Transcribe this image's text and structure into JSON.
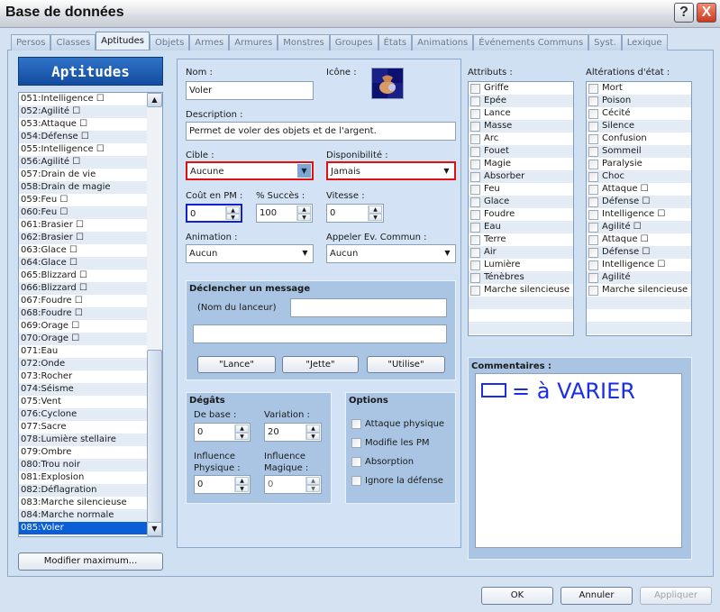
{
  "window": {
    "title": "Base de données",
    "help_label": "?",
    "close_label": "X"
  },
  "tabs": [
    "Persos",
    "Classes",
    "Aptitudes",
    "Objets",
    "Armes",
    "Armures",
    "Monstres",
    "Groupes",
    "États",
    "Animations",
    "Événements Communs",
    "Syst.",
    "Lexique"
  ],
  "active_tab": "Aptitudes",
  "sidebar": {
    "title": "Aptitudes",
    "items": [
      "051:Intelligence ☐",
      "052:Agilité ☐",
      "053:Attaque ☐",
      "054:Défense ☐",
      "055:Intelligence ☐",
      "056:Agilité ☐",
      "057:Drain de vie",
      "058:Drain de magie",
      "059:Feu ☐",
      "060:Feu ☐",
      "061:Brasier ☐",
      "062:Brasier ☐",
      "063:Glace ☐",
      "064:Glace ☐",
      "065:Blizzard ☐",
      "066:Blizzard ☐",
      "067:Foudre ☐",
      "068:Foudre ☐",
      "069:Orage ☐",
      "070:Orage ☐",
      "071:Eau",
      "072:Onde",
      "073:Rocher",
      "074:Séisme",
      "075:Vent",
      "076:Cyclone",
      "077:Sacre",
      "078:Lumière stellaire",
      "079:Ombre",
      "080:Trou noir",
      "081:Explosion",
      "082:Déflagration",
      "083:Marche silencieuse",
      "084:Marche normale",
      "085:Voler"
    ],
    "selected": "085:Voler",
    "max_button": "Modifier maximum..."
  },
  "form": {
    "name_label": "Nom :",
    "name_value": "Voler",
    "icon_label": "Icône :",
    "desc_label": "Description :",
    "desc_value": "Permet de voler des objets et de l'argent.",
    "target_label": "Cible :",
    "target_value": "Aucune",
    "avail_label": "Disponibilité :",
    "avail_value": "Jamais",
    "mp_label": "Coût en PM :",
    "mp_value": "0",
    "success_label": "% Succès :",
    "success_value": "100",
    "speed_label": "Vitesse :",
    "speed_value": "0",
    "anim_label": "Animation :",
    "anim_value": "Aucun",
    "event_label": "Appeler Ev. Commun :",
    "event_value": "Aucun",
    "message": {
      "title": "Déclencher un message",
      "caster_label": "(Nom du lanceur)",
      "caster_value": "",
      "line2_value": "",
      "buttons": [
        "\"Lance\"",
        "\"Jette\"",
        "\"Utilise\""
      ]
    },
    "damage": {
      "title": "Dégâts",
      "base_label": "De base :",
      "base_value": "0",
      "var_label": "Variation :",
      "var_value": "20",
      "phys_label1": "Influence",
      "phys_label2": "Physique :",
      "phys_value": "0",
      "mag_label1": "Influence",
      "mag_label2": "Magique :",
      "mag_value": "0"
    },
    "options": {
      "title": "Options",
      "items": [
        "Attaque physique",
        "Modifie les PM",
        "Absorption",
        "Ignore la défense"
      ]
    }
  },
  "attributes": {
    "label": "Attributs :",
    "items": [
      "Griffe",
      "Epée",
      "Lance",
      "Masse",
      "Arc",
      "Fouet",
      "Magie",
      "Absorber",
      "Feu",
      "Glace",
      "Foudre",
      "Eau",
      "Terre",
      "Air",
      "Lumière",
      "Ténèbres",
      "Marche silencieuse"
    ]
  },
  "states": {
    "label": "Altérations d'état :",
    "items": [
      "Mort",
      "Poison",
      "Cécité",
      "Silence",
      "Confusion",
      "Sommeil",
      "Paralysie",
      "Choc",
      "Attaque ☐",
      "Défense ☐",
      "Intelligence ☐",
      "Agilité ☐",
      "Attaque ☐",
      "Défense ☐",
      "Intelligence ☐",
      "Agilité",
      "Marche silencieuse"
    ]
  },
  "comments": {
    "label": "Commentaires :",
    "handwriting": "= à VARIER",
    "ink_color": "#1a2ee8"
  },
  "footer": {
    "ok": "OK",
    "cancel": "Annuler",
    "apply": "Appliquer"
  }
}
